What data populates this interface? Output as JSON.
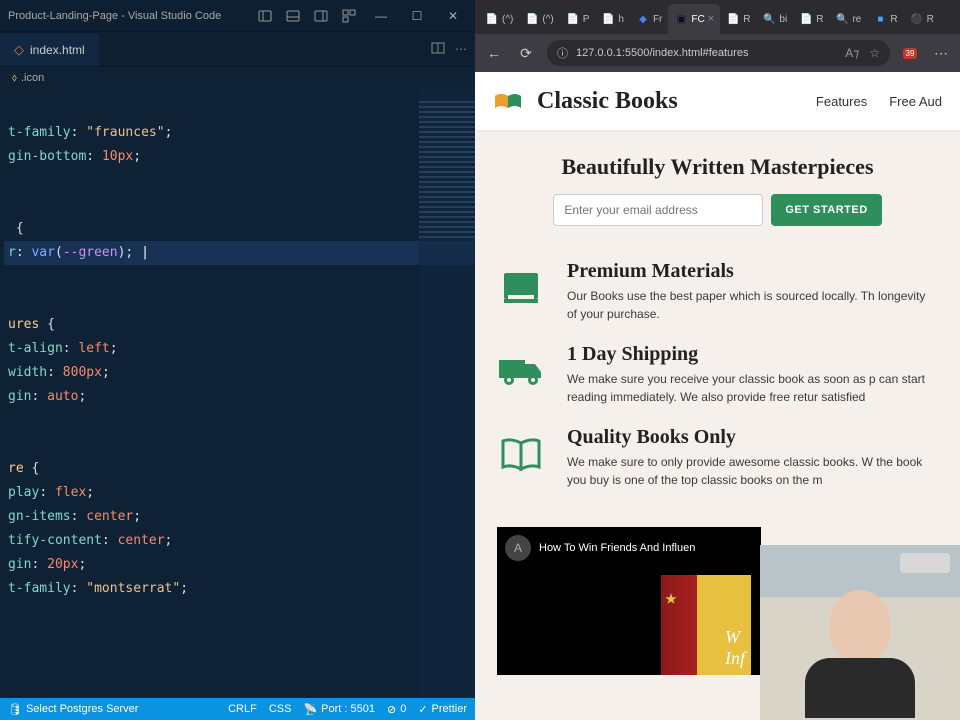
{
  "vscode": {
    "window_title": "Product-Landing-Page - Visual Studio Code",
    "tab": {
      "filename": "index.html"
    },
    "breadcrumb": {
      "item": ".icon"
    },
    "code_lines": [
      "",
      "t-family: \"fraunces\";",
      "gin-bottom: 10px;",
      "",
      "",
      "{",
      "r: var(--green);",
      "",
      "",
      "ures {",
      "t-align: left;",
      "width: 800px;",
      "gin: auto;",
      "",
      "",
      "re {",
      "play: flex;",
      "gn-items: center;",
      "tify-content: center;",
      "gin: 20px;",
      "t-family: \"montserrat\";",
      ""
    ],
    "statusbar": {
      "postgres": "Select Postgres Server",
      "eol": "CRLF",
      "lang": "CSS",
      "port": "Port : 5501",
      "errors": "0",
      "prettier": "Prettier"
    }
  },
  "edge": {
    "tabs": [
      {
        "label": "(^)",
        "active": false
      },
      {
        "label": "(^)",
        "active": false
      },
      {
        "label": "P",
        "active": false
      },
      {
        "label": "h",
        "active": false
      },
      {
        "label": "Fr",
        "active": false
      },
      {
        "label": "FC",
        "active": true
      },
      {
        "label": "R",
        "active": false
      },
      {
        "label": "bi",
        "active": false
      },
      {
        "label": "R",
        "active": false
      },
      {
        "label": "re",
        "active": false
      },
      {
        "label": "R",
        "active": false
      },
      {
        "label": "R",
        "active": false
      }
    ],
    "url": "127.0.0.1:5500/index.html#features",
    "ext_badge": "39"
  },
  "page": {
    "brand": "Classic Books",
    "nav": {
      "features": "Features",
      "free_audio": "Free Aud"
    },
    "hero": {
      "title": "Beautifully Written Masterpieces",
      "placeholder": "Enter your email address",
      "cta": "GET STARTED"
    },
    "features": [
      {
        "title": "Premium Materials",
        "desc": "Our Books use the best paper which is sourced locally. Th longevity of your purchase."
      },
      {
        "title": "1 Day Shipping",
        "desc": "We make sure you receive your classic book as soon as p can start reading immediately. We also provide free retur satisfied"
      },
      {
        "title": "Quality Books Only",
        "desc": "We make sure to only provide awesome classic books. W the book you buy is one of the top classic books on the m"
      }
    ],
    "video": {
      "title": "How To Win Friends And Influen",
      "avatar_letter": "A",
      "book_text_1": "W",
      "book_text_2": "Inf"
    }
  }
}
